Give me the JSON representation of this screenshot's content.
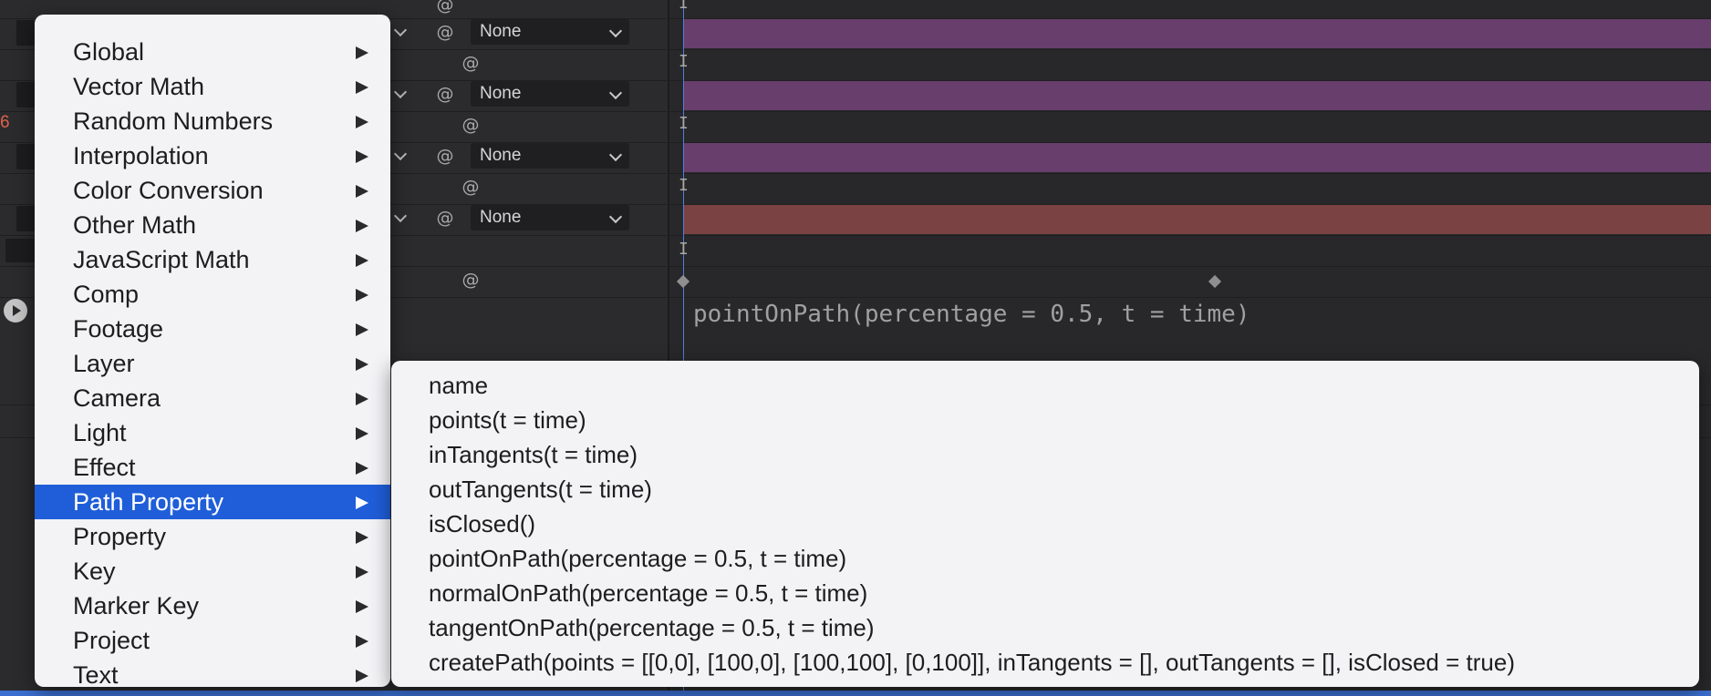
{
  "timeline": {
    "dropdown_value": "None",
    "red_value": "6",
    "expression_text": "pointOnPath(percentage = 0.5, t = time)",
    "ibeam_glyph": "I",
    "spiral_glyph": "@",
    "colors": {
      "purple_bar": "#673e6c",
      "red_bar": "#7a4242",
      "time_indicator": "#4f7fdc"
    }
  },
  "menu": {
    "items": [
      {
        "label": "Global",
        "highlighted": false
      },
      {
        "label": "Vector Math",
        "highlighted": false
      },
      {
        "label": "Random Numbers",
        "highlighted": false
      },
      {
        "label": "Interpolation",
        "highlighted": false
      },
      {
        "label": "Color Conversion",
        "highlighted": false
      },
      {
        "label": "Other Math",
        "highlighted": false
      },
      {
        "label": "JavaScript Math",
        "highlighted": false
      },
      {
        "label": "Comp",
        "highlighted": false
      },
      {
        "label": "Footage",
        "highlighted": false
      },
      {
        "label": "Layer",
        "highlighted": false
      },
      {
        "label": "Camera",
        "highlighted": false
      },
      {
        "label": "Light",
        "highlighted": false
      },
      {
        "label": "Effect",
        "highlighted": false
      },
      {
        "label": "Path Property",
        "highlighted": true
      },
      {
        "label": "Property",
        "highlighted": false
      },
      {
        "label": "Key",
        "highlighted": false
      },
      {
        "label": "Marker Key",
        "highlighted": false
      },
      {
        "label": "Project",
        "highlighted": false
      },
      {
        "label": "Text",
        "highlighted": false
      }
    ],
    "highlight_color": "#1f5ed8"
  },
  "submenu": {
    "items": [
      "name",
      "points(t = time)",
      "inTangents(t = time)",
      "outTangents(t = time)",
      "isClosed()",
      "pointOnPath(percentage = 0.5, t = time)",
      "normalOnPath(percentage = 0.5, t = time)",
      "tangentOnPath(percentage = 0.5, t = time)",
      "createPath(points = [[0,0], [100,0], [100,100], [0,100]], inTangents = [], outTangents = [], isClosed = true)"
    ]
  }
}
